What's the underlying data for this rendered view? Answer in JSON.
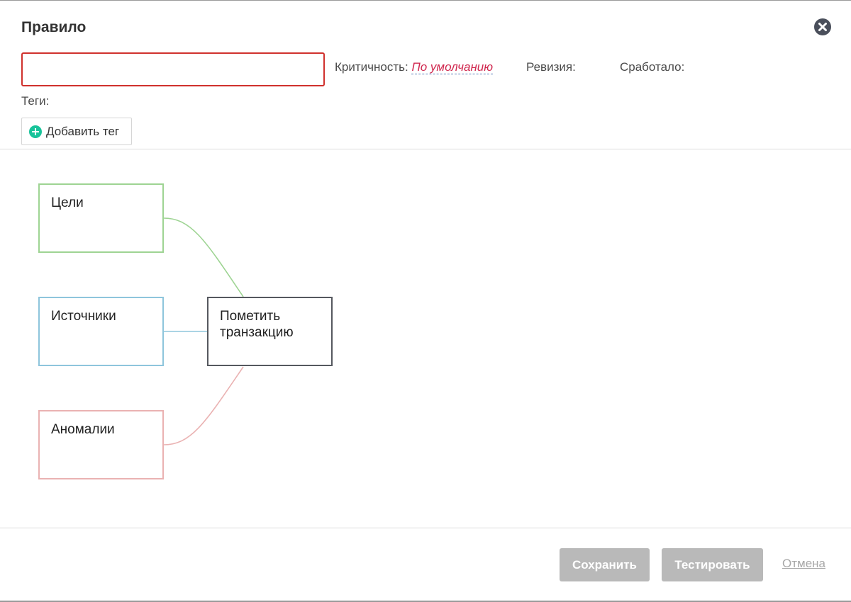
{
  "dialog": {
    "title": "Правило",
    "close_icon": "close-icon"
  },
  "form": {
    "name_value": "",
    "name_placeholder": "",
    "criticality_label": "Критичность:",
    "criticality_value": "По умолчанию",
    "revision_label": "Ревизия:",
    "triggered_label": "Сработало:",
    "tags_label": "Теги:",
    "add_tag_label": "Добавить тег",
    "add_tag_icon": "plus-circle-icon"
  },
  "diagram": {
    "nodes": {
      "goals": "Цели",
      "sources": "Источники",
      "anomalies": "Аномалии",
      "action_line1": "Пометить",
      "action_line2": "транзакцию"
    },
    "colors": {
      "goals": "#9ed493",
      "sources": "#8ec5dc",
      "anomalies": "#eab2b2",
      "action": "#55585f"
    }
  },
  "footer": {
    "save_label": "Сохранить",
    "test_label": "Тестировать",
    "cancel_label": "Отмена"
  },
  "colors": {
    "error_border": "#d0312d",
    "criticality_link": "#d0284f",
    "disabled_button": "#b9b9b9",
    "add_icon": "#18c39a"
  }
}
